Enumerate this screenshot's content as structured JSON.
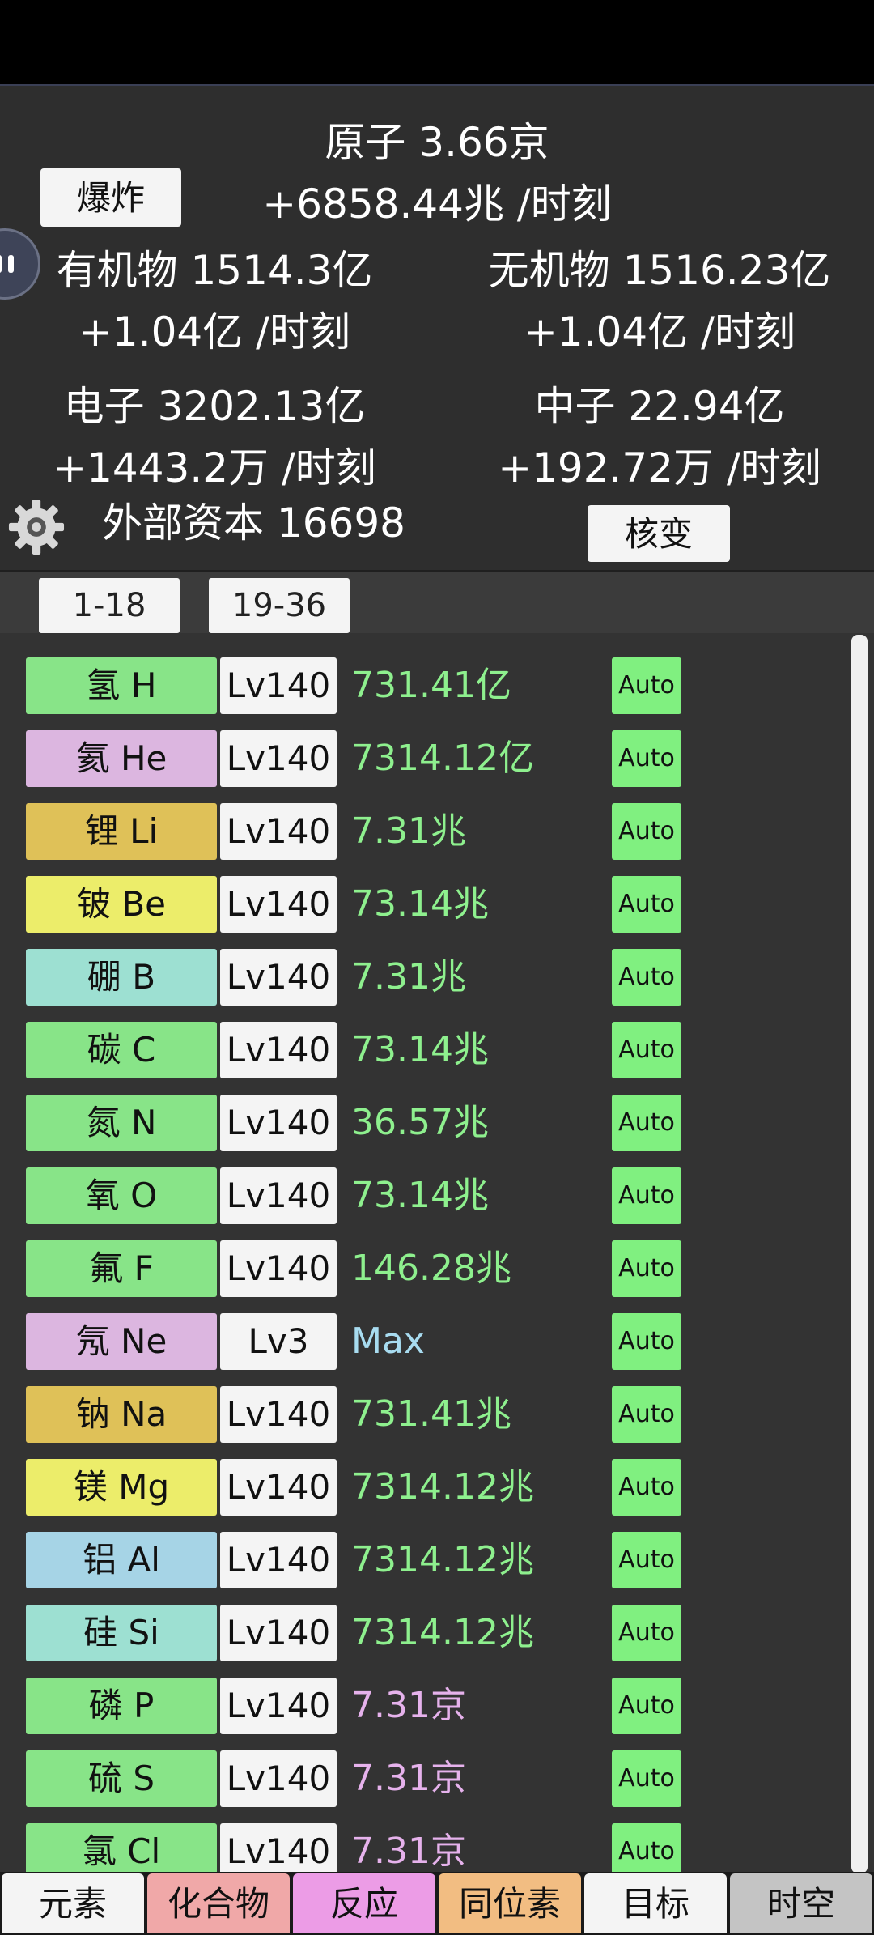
{
  "header": {
    "atoms_line": "原子 3.66京",
    "atoms_rate": "+6858.44兆 /时刻",
    "explode_label": "爆炸",
    "organic_line": "有机物 1514.3亿",
    "organic_rate": "+1.04亿 /时刻",
    "inorganic_line": "无机物 1516.23亿",
    "inorganic_rate": "+1.04亿 /时刻",
    "electron_line": "电子 3202.13亿",
    "electron_rate": "+1443.2万 /时刻",
    "neutron_line": "中子 22.94亿",
    "neutron_rate": "+192.72万 /时刻",
    "capital_line": "外部资本 16698",
    "fission_label": "核变"
  },
  "range_tabs": [
    "1-18",
    "19-36"
  ],
  "colors": {
    "green_bg": "#88e488",
    "pink_bg": "#dcb6e0",
    "gold_bg": "#dfc158",
    "yellow_bg": "#eced6a",
    "teal_bg": "#9de0d2",
    "blue_bg": "#a6d4e6",
    "value_green": "#8ef08e",
    "value_blue": "#a8dcf0",
    "value_pink": "#e6b2ec"
  },
  "elements": [
    {
      "name": "氢 H",
      "level": "Lv140",
      "value": "731.41亿",
      "auto": "Auto",
      "bg": "#88e488",
      "vc": "#8ef08e"
    },
    {
      "name": "氦 He",
      "level": "Lv140",
      "value": "7314.12亿",
      "auto": "Auto",
      "bg": "#dcb6e0",
      "vc": "#8ef08e"
    },
    {
      "name": "锂 Li",
      "level": "Lv140",
      "value": "7.31兆",
      "auto": "Auto",
      "bg": "#dfc158",
      "vc": "#8ef08e"
    },
    {
      "name": "铍 Be",
      "level": "Lv140",
      "value": "73.14兆",
      "auto": "Auto",
      "bg": "#eced6a",
      "vc": "#8ef08e"
    },
    {
      "name": "硼 B",
      "level": "Lv140",
      "value": "7.31兆",
      "auto": "Auto",
      "bg": "#9de0d2",
      "vc": "#8ef08e"
    },
    {
      "name": "碳 C",
      "level": "Lv140",
      "value": "73.14兆",
      "auto": "Auto",
      "bg": "#88e488",
      "vc": "#8ef08e"
    },
    {
      "name": "氮 N",
      "level": "Lv140",
      "value": "36.57兆",
      "auto": "Auto",
      "bg": "#88e488",
      "vc": "#8ef08e"
    },
    {
      "name": "氧 O",
      "level": "Lv140",
      "value": "73.14兆",
      "auto": "Auto",
      "bg": "#88e488",
      "vc": "#8ef08e"
    },
    {
      "name": "氟 F",
      "level": "Lv140",
      "value": "146.28兆",
      "auto": "Auto",
      "bg": "#88e488",
      "vc": "#8ef08e"
    },
    {
      "name": "氖 Ne",
      "level": "Lv3",
      "value": "Max",
      "auto": "Auto",
      "bg": "#dcb6e0",
      "vc": "#a8dcf0"
    },
    {
      "name": "钠 Na",
      "level": "Lv140",
      "value": "731.41兆",
      "auto": "Auto",
      "bg": "#dfc158",
      "vc": "#8ef08e"
    },
    {
      "name": "镁 Mg",
      "level": "Lv140",
      "value": "7314.12兆",
      "auto": "Auto",
      "bg": "#eced6a",
      "vc": "#8ef08e"
    },
    {
      "name": "铝 Al",
      "level": "Lv140",
      "value": "7314.12兆",
      "auto": "Auto",
      "bg": "#a6d4e6",
      "vc": "#8ef08e"
    },
    {
      "name": "硅 Si",
      "level": "Lv140",
      "value": "7314.12兆",
      "auto": "Auto",
      "bg": "#9de0d2",
      "vc": "#8ef08e"
    },
    {
      "name": "磷 P",
      "level": "Lv140",
      "value": "7.31京",
      "auto": "Auto",
      "bg": "#88e488",
      "vc": "#e6b2ec"
    },
    {
      "name": "硫 S",
      "level": "Lv140",
      "value": "7.31京",
      "auto": "Auto",
      "bg": "#88e488",
      "vc": "#e6b2ec"
    },
    {
      "name": "氯 Cl",
      "level": "Lv140",
      "value": "7.31京",
      "auto": "Auto",
      "bg": "#88e488",
      "vc": "#e6b2ec"
    }
  ],
  "nav": [
    {
      "label": "元素",
      "bg": "#f4f4f4"
    },
    {
      "label": "化合物",
      "bg": "#f0a8a8"
    },
    {
      "label": "反应",
      "bg": "#ec9ce6"
    },
    {
      "label": "同位素",
      "bg": "#f2bd82"
    },
    {
      "label": "目标",
      "bg": "#f4f4f4"
    },
    {
      "label": "时空",
      "bg": "#c4c4c4"
    }
  ]
}
